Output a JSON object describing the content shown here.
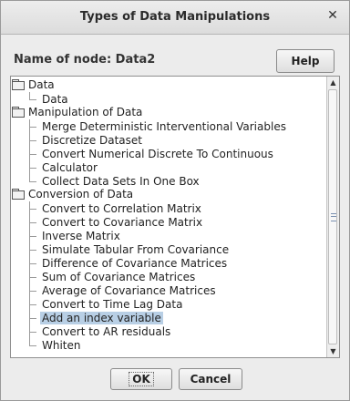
{
  "window": {
    "title": "Types of Data Manipulations",
    "close_glyph": "✕"
  },
  "header": {
    "node_label": "Name of node: Data2",
    "help_label": "Help"
  },
  "tree": {
    "groups": [
      {
        "label": "Data",
        "items": [
          "Data"
        ]
      },
      {
        "label": "Manipulation of Data",
        "items": [
          "Merge Deterministic Interventional Variables",
          "Discretize Dataset",
          "Convert Numerical Discrete To Continuous",
          "Calculator",
          "Collect Data Sets In One Box"
        ]
      },
      {
        "label": "Conversion of Data",
        "items": [
          "Convert to Correlation Matrix",
          "Convert to Covariance Matrix",
          "Inverse Matrix",
          "Simulate Tabular From Covariance",
          "Difference of Covariance Matrices",
          "Sum of Covariance Matrices",
          "Average of Covariance Matrices",
          "Convert to Time Lag Data",
          "Add an index variable",
          "Convert to AR residuals",
          "Whiten"
        ]
      }
    ],
    "selected_item": "Add an index variable"
  },
  "scrollbar": {
    "up_arrow": "▲",
    "down_arrow": "▼"
  },
  "buttons": {
    "ok_label": "OK",
    "cancel_label": "Cancel"
  }
}
